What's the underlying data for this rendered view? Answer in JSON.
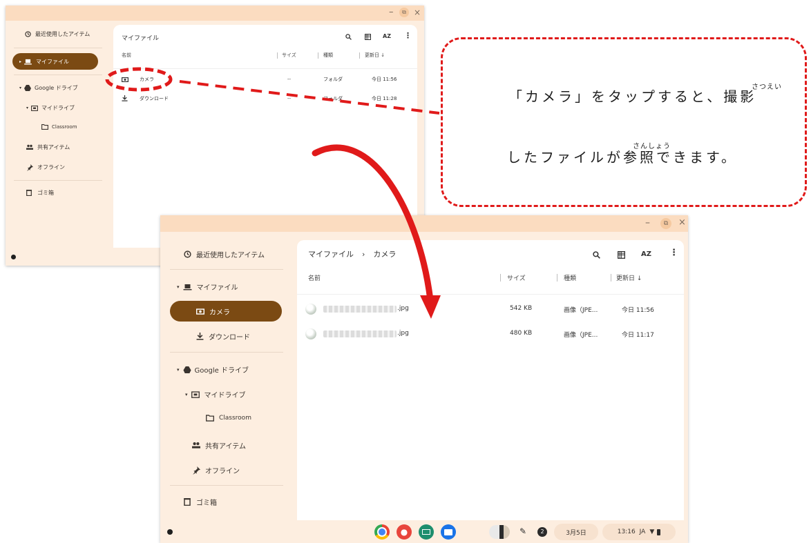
{
  "window1": {
    "sidebar": {
      "recent": "最近使用したアイテム",
      "my_files": "マイファイル",
      "google_drive": "Google ドライブ",
      "my_drive": "マイドライブ",
      "classroom": "Classroom",
      "shared": "共有アイテム",
      "offline": "オフライン",
      "trash": "ゴミ箱"
    },
    "header": {
      "title": "マイファイル",
      "sort_label": "AZ"
    },
    "columns": {
      "name": "名前",
      "size": "サイズ",
      "type": "種類",
      "modified": "更新日 ↓"
    },
    "rows": [
      {
        "name": "カメラ",
        "size": "--",
        "type": "フォルダ",
        "modified": "今日 11:56"
      },
      {
        "name": "ダウンロード",
        "size": "--",
        "type": "フォルダ",
        "modified": "今日 11:28"
      }
    ]
  },
  "window2": {
    "sidebar": {
      "recent": "最近使用したアイテム",
      "my_files": "マイファイル",
      "camera": "カメラ",
      "downloads": "ダウンロード",
      "google_drive": "Google ドライブ",
      "my_drive": "マイドライブ",
      "classroom": "Classroom",
      "shared": "共有アイテム",
      "offline": "オフライン",
      "trash": "ゴミ箱"
    },
    "breadcrumb": {
      "root": "マイファイル",
      "separator": "›",
      "current": "カメラ"
    },
    "header": {
      "sort_label": "AZ"
    },
    "columns": {
      "name": "名前",
      "size": "サイズ",
      "type": "種類",
      "modified": "更新日 ↓"
    },
    "files": [
      {
        "ext": ".jpg",
        "size": "542 KB",
        "type": "画像（JPE...",
        "modified": "今日 11:56"
      },
      {
        "ext": ".jpg",
        "size": "480 KB",
        "type": "画像（JPE...",
        "modified": "今日 11:17"
      }
    ],
    "shelf": {
      "date": "3月5日",
      "time": "13:16",
      "ime": "JA"
    }
  },
  "callout": {
    "line1": "「カメラ」をタップすると、撮影",
    "line2": "したファイルが参照できます。",
    "ruby1": "さつえい",
    "ruby2": "さんしょう"
  },
  "colors": {
    "accent": "#7b4a13",
    "annotation": "#e01a1a",
    "titlebar": "#fbdcc0",
    "sidebar": "#fdeee0"
  }
}
